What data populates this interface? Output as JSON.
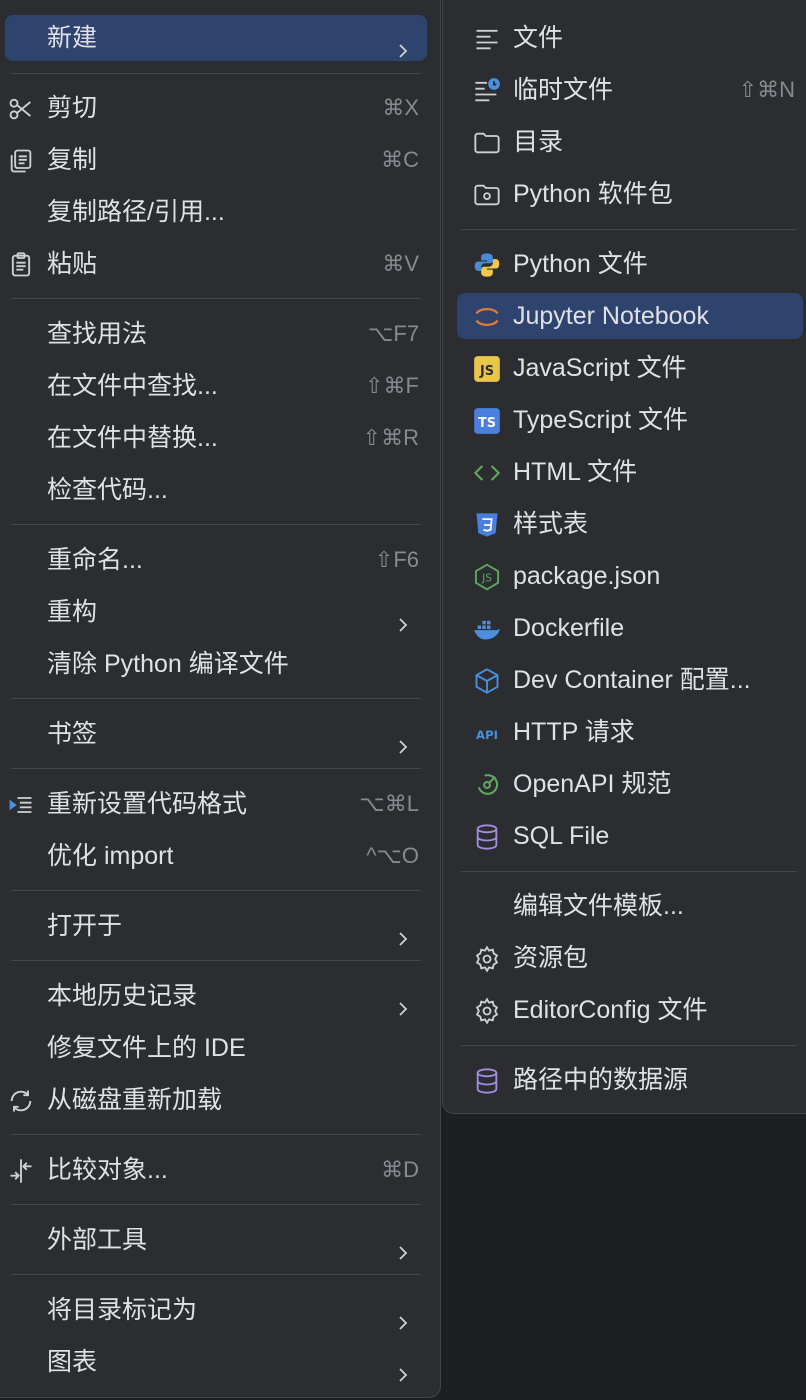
{
  "main_menu": {
    "items": [
      {
        "label": "新建",
        "shortcut": "",
        "submenu": true,
        "icon": "",
        "selected": true
      },
      {
        "label": "剪切",
        "shortcut": "⌘X",
        "submenu": false,
        "icon": "scissors-icon"
      },
      {
        "label": "复制",
        "shortcut": "⌘C",
        "submenu": false,
        "icon": "copy-icon"
      },
      {
        "label": "复制路径/引用...",
        "shortcut": "",
        "submenu": false,
        "icon": ""
      },
      {
        "label": "粘贴",
        "shortcut": "⌘V",
        "submenu": false,
        "icon": "clipboard-icon"
      },
      {
        "label": "查找用法",
        "shortcut": "⌥F7",
        "submenu": false,
        "icon": ""
      },
      {
        "label": "在文件中查找...",
        "shortcut": "⇧⌘F",
        "submenu": false,
        "icon": ""
      },
      {
        "label": "在文件中替换...",
        "shortcut": "⇧⌘R",
        "submenu": false,
        "icon": ""
      },
      {
        "label": "检查代码...",
        "shortcut": "",
        "submenu": false,
        "icon": ""
      },
      {
        "label": "重命名...",
        "shortcut": "⇧F6",
        "submenu": false,
        "icon": ""
      },
      {
        "label": "重构",
        "shortcut": "",
        "submenu": true,
        "icon": ""
      },
      {
        "label": "清除 Python 编译文件",
        "shortcut": "",
        "submenu": false,
        "icon": ""
      },
      {
        "label": "书签",
        "shortcut": "",
        "submenu": true,
        "icon": ""
      },
      {
        "label": "重新设置代码格式",
        "shortcut": "⌥⌘L",
        "submenu": false,
        "icon": "reformat-icon"
      },
      {
        "label": "优化 import",
        "shortcut": "^⌥O",
        "submenu": false,
        "icon": ""
      },
      {
        "label": "打开于",
        "shortcut": "",
        "submenu": true,
        "icon": ""
      },
      {
        "label": "本地历史记录",
        "shortcut": "",
        "submenu": true,
        "icon": ""
      },
      {
        "label": "修复文件上的 IDE",
        "shortcut": "",
        "submenu": false,
        "icon": ""
      },
      {
        "label": "从磁盘重新加载",
        "shortcut": "",
        "submenu": false,
        "icon": "reload-icon"
      },
      {
        "label": "比较对象...",
        "shortcut": "⌘D",
        "submenu": false,
        "icon": "compare-icon"
      },
      {
        "label": "外部工具",
        "shortcut": "",
        "submenu": true,
        "icon": ""
      },
      {
        "label": "将目录标记为",
        "shortcut": "",
        "submenu": true,
        "icon": ""
      },
      {
        "label": "图表",
        "shortcut": "",
        "submenu": true,
        "icon": ""
      }
    ]
  },
  "sub_menu": {
    "items": [
      {
        "label": "文件",
        "shortcut": "",
        "icon": "text-file-icon"
      },
      {
        "label": "临时文件",
        "shortcut": "⇧⌘N",
        "icon": "scratch-file-icon"
      },
      {
        "label": "目录",
        "shortcut": "",
        "icon": "folder-icon"
      },
      {
        "label": "Python 软件包",
        "shortcut": "",
        "icon": "package-folder-icon"
      },
      {
        "label": "Python 文件",
        "shortcut": "",
        "icon": "python-icon"
      },
      {
        "label": "Jupyter Notebook",
        "shortcut": "",
        "icon": "jupyter-icon",
        "selected": true
      },
      {
        "label": "JavaScript 文件",
        "shortcut": "",
        "icon": "javascript-icon"
      },
      {
        "label": "TypeScript 文件",
        "shortcut": "",
        "icon": "typescript-icon"
      },
      {
        "label": "HTML 文件",
        "shortcut": "",
        "icon": "html-icon"
      },
      {
        "label": "样式表",
        "shortcut": "",
        "icon": "css-icon"
      },
      {
        "label": "package.json",
        "shortcut": "",
        "icon": "nodejs-icon"
      },
      {
        "label": "Dockerfile",
        "shortcut": "",
        "icon": "docker-icon"
      },
      {
        "label": "Dev Container 配置...",
        "shortcut": "",
        "icon": "cube-icon"
      },
      {
        "label": "HTTP 请求",
        "shortcut": "",
        "icon": "api-icon"
      },
      {
        "label": "OpenAPI 规范",
        "shortcut": "",
        "icon": "openapi-icon"
      },
      {
        "label": "SQL File",
        "shortcut": "",
        "icon": "database-icon"
      },
      {
        "label": "编辑文件模板...",
        "shortcut": "",
        "icon": ""
      },
      {
        "label": "资源包",
        "shortcut": "",
        "icon": "gear-icon"
      },
      {
        "label": "EditorConfig 文件",
        "shortcut": "",
        "icon": "gear-icon"
      },
      {
        "label": "路径中的数据源",
        "shortcut": "",
        "icon": "database-icon"
      }
    ]
  },
  "colors": {
    "menu_bg": "#2b2d30",
    "selection": "#2e436e",
    "text": "#dfe1e5",
    "shortcut_text": "#868a91",
    "separator": "#43454a",
    "python_blue": "#4a8bd8",
    "python_yellow": "#f2c94c",
    "jupyter_orange": "#e07b39",
    "js_yellow": "#e8c64a",
    "ts_blue": "#4a7fe0",
    "green": "#5fa860",
    "docker_blue": "#4a8fe0",
    "db_purple": "#a48ce0"
  }
}
